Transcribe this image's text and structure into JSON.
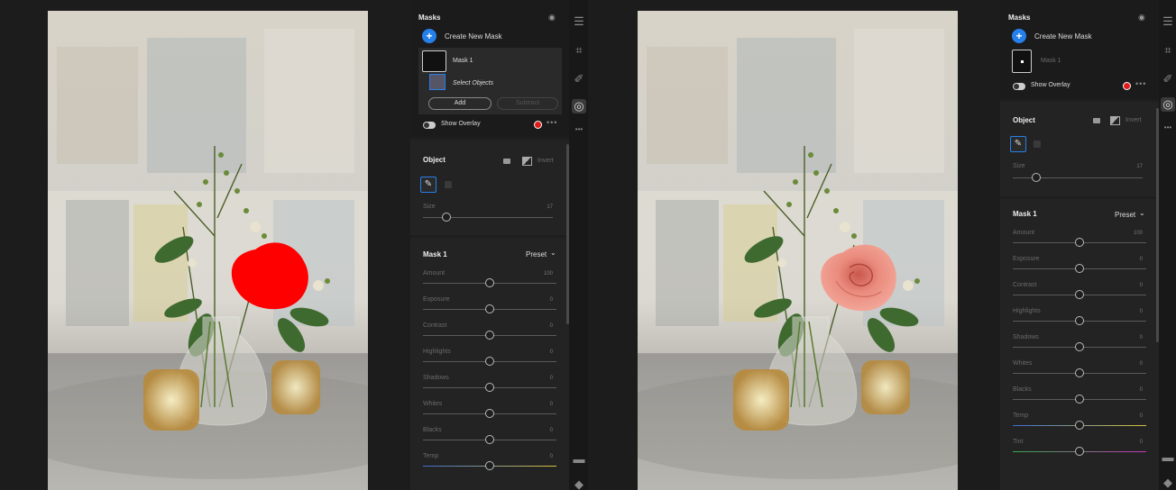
{
  "left": {
    "masks_panel": {
      "title": "Masks",
      "create_label": "Create New Mask",
      "mask_name": "Mask 1",
      "select_objects_label": "Select Objects",
      "add_label": "Add",
      "subtract_label": "Subtract",
      "show_overlay_label": "Show Overlay"
    },
    "object_panel": {
      "title": "Object",
      "invert_label": "Invert",
      "size_label": "Size",
      "size_value": "17"
    },
    "mask_adjust": {
      "title": "Mask 1",
      "preset_label": "Preset",
      "sliders": [
        {
          "label": "Amount",
          "value": "100",
          "pos": 0.5
        },
        {
          "label": "Exposure",
          "value": "0",
          "pos": 0.5
        },
        {
          "label": "Contrast",
          "value": "0",
          "pos": 0.5
        },
        {
          "label": "Highlights",
          "value": "0",
          "pos": 0.5
        },
        {
          "label": "Shadows",
          "value": "0",
          "pos": 0.5
        },
        {
          "label": "Whites",
          "value": "0",
          "pos": 0.5
        },
        {
          "label": "Blacks",
          "value": "0",
          "pos": 0.5
        },
        {
          "label": "Temp",
          "value": "0",
          "pos": 0.5
        }
      ]
    }
  },
  "right": {
    "masks_panel": {
      "title": "Masks",
      "create_label": "Create New Mask",
      "mask_name": "Mask 1",
      "show_overlay_label": "Show Overlay"
    },
    "object_panel": {
      "title": "Object",
      "invert_label": "Invert",
      "size_label": "Size",
      "size_value": "17"
    },
    "mask_adjust": {
      "title": "Mask 1",
      "preset_label": "Preset",
      "sliders": [
        {
          "label": "Amount",
          "value": "100",
          "pos": 0.5
        },
        {
          "label": "Exposure",
          "value": "0",
          "pos": 0.5
        },
        {
          "label": "Contrast",
          "value": "0",
          "pos": 0.5
        },
        {
          "label": "Highlights",
          "value": "0",
          "pos": 0.5
        },
        {
          "label": "Shadows",
          "value": "0",
          "pos": 0.5
        },
        {
          "label": "Whites",
          "value": "0",
          "pos": 0.5
        },
        {
          "label": "Blacks",
          "value": "0",
          "pos": 0.5
        },
        {
          "label": "Temp",
          "value": "0",
          "pos": 0.5
        },
        {
          "label": "Tint",
          "value": "0",
          "pos": 0.5
        }
      ]
    }
  },
  "size_slider_pos": 0.18,
  "colors": {
    "accent": "#2680eb",
    "overlay_red": "#e01a1a",
    "panel_bg": "#232323"
  },
  "icons": [
    "edit-sliders-icon",
    "crop-icon",
    "heal-icon",
    "masking-icon",
    "more-icon",
    "comment-icon",
    "tag-icon",
    "eye-icon"
  ]
}
